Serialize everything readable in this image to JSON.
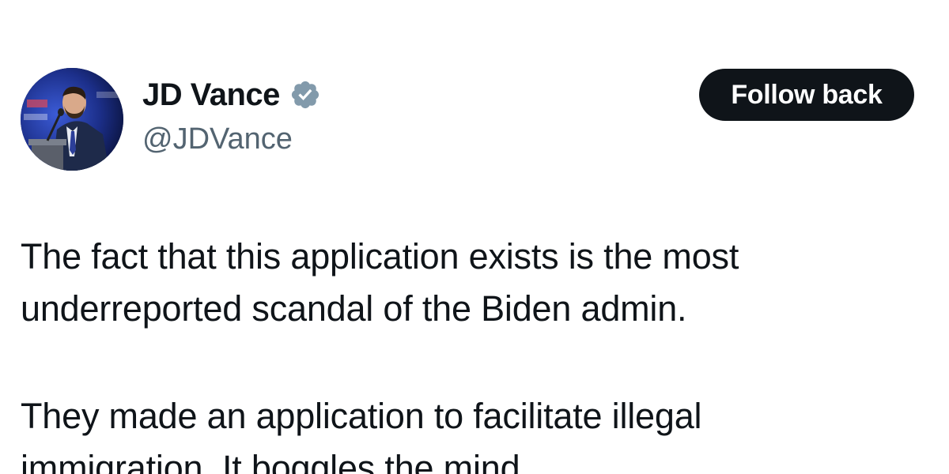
{
  "author": {
    "display_name": "JD Vance",
    "handle": "@JDVance",
    "verified": true,
    "verified_color": "#829aab",
    "avatar_icon": "profile-photo"
  },
  "actions": {
    "follow_label": "Follow back"
  },
  "tweet": {
    "paragraph_1": "The fact that this application exists is the most\nunderreported scandal of the Biden admin.",
    "paragraph_2": "They made an application to facilitate illegal\nimmigration. It boggles the mind."
  },
  "colors": {
    "text_primary": "#0f1419",
    "text_secondary": "#536471",
    "button_bg": "#0f1419",
    "button_text": "#ffffff"
  }
}
